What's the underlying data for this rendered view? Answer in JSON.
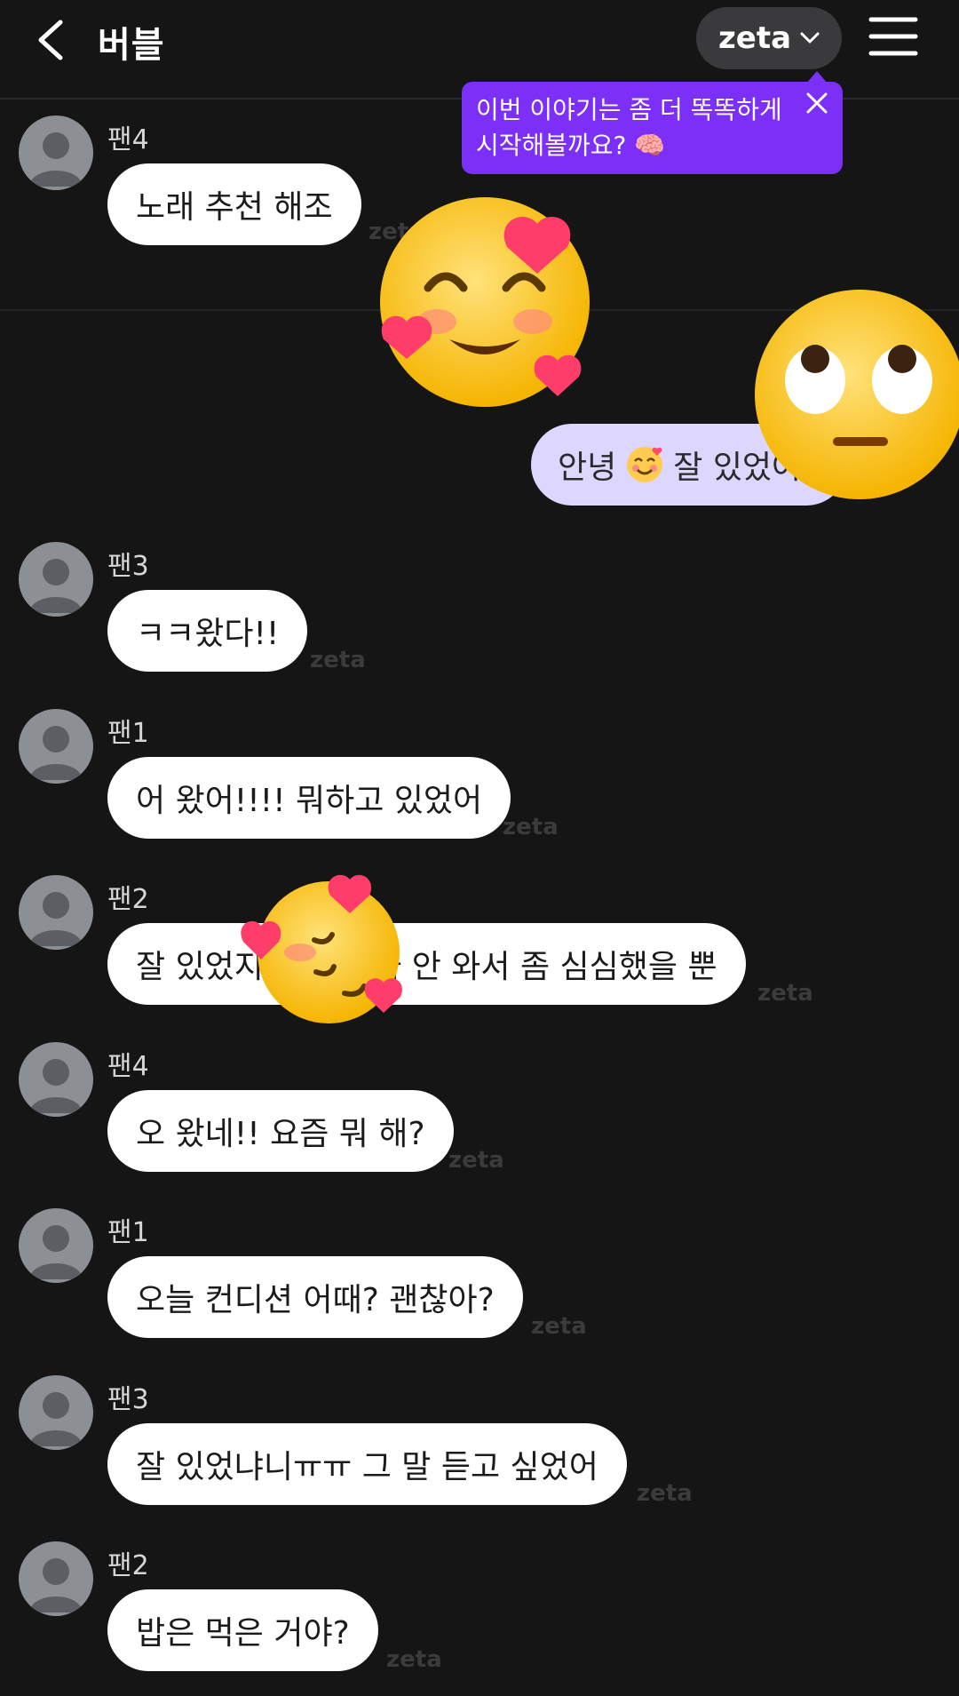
{
  "header": {
    "title": "버블",
    "model_label": "zeta",
    "back_icon": "chevron-left-icon",
    "menu_icon": "hamburger-menu-icon"
  },
  "tooltip": {
    "line1": "이번 이야기는 좀 더 똑똑하게",
    "line2": "시작해볼까요? 🧠",
    "color": "#7b2ff7"
  },
  "pinned": {
    "sender": "팬4",
    "text": "노래 추천 해조",
    "stamp": "zeta"
  },
  "my_message": {
    "text_before": "안녕",
    "text_after": "잘 있었어?"
  },
  "messages": [
    {
      "sender": "팬3",
      "text": "ㅋㅋ왔다!!",
      "stamp": "zeta"
    },
    {
      "sender": "팬1",
      "text": "어 왔어!!!! 뭐하고 있었어",
      "stamp": "zeta"
    },
    {
      "sender": "팬2",
      "text": "잘 있었지 ㅎㅎ 니가 안 와서 좀 심심했을 뿐",
      "stamp": "zeta"
    },
    {
      "sender": "팬4",
      "text": "오 왔네!! 요즘 뭐 해?",
      "stamp": "zeta"
    },
    {
      "sender": "팬1",
      "text": "오늘 컨디션 어때? 괜찮아?",
      "stamp": "zeta"
    },
    {
      "sender": "팬3",
      "text": "잘 있었냐니ㅠㅠ 그 말 듣고 싶었어",
      "stamp": "zeta"
    },
    {
      "sender": "팬2",
      "text": "밥은 먹은 거야?",
      "stamp": "zeta"
    }
  ],
  "colors": {
    "background": "#151516",
    "bubble": "#ffffff",
    "my_bubble": "#ddd6ff",
    "accent": "#7b2ff7"
  },
  "reactions": [
    "smiling-face-with-hearts-icon",
    "face-with-rolling-eyes-icon",
    "smiling-face-with-hearts-small-icon",
    "sleepy-face-with-hearts-icon"
  ]
}
